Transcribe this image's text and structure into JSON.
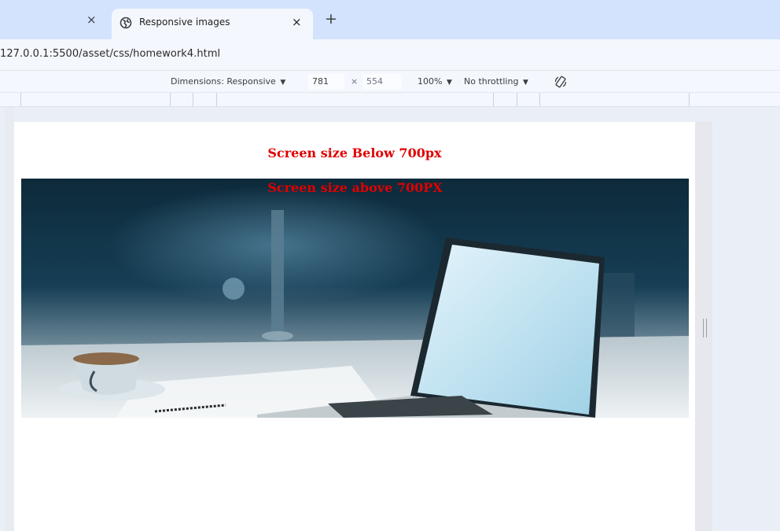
{
  "browser": {
    "active_tab_title": "Responsive images",
    "close_glyph": "×",
    "new_tab_glyph": "+",
    "url": "127.0.0.1:5500/asset/css/homework4.html"
  },
  "device_toolbar": {
    "dimensions_label": "Dimensions: Responsive",
    "width": "781",
    "times": "×",
    "height": "554",
    "zoom": "100%",
    "throttling": "No throttling",
    "dropdown_glyph": "▼",
    "rotate_icon": "rotate-icon"
  },
  "page": {
    "heading_below": "Screen size Below 700px",
    "heading_above": "Screen size above 700PX",
    "hero_image": "laptop-and-coffee-cup-photo"
  }
}
